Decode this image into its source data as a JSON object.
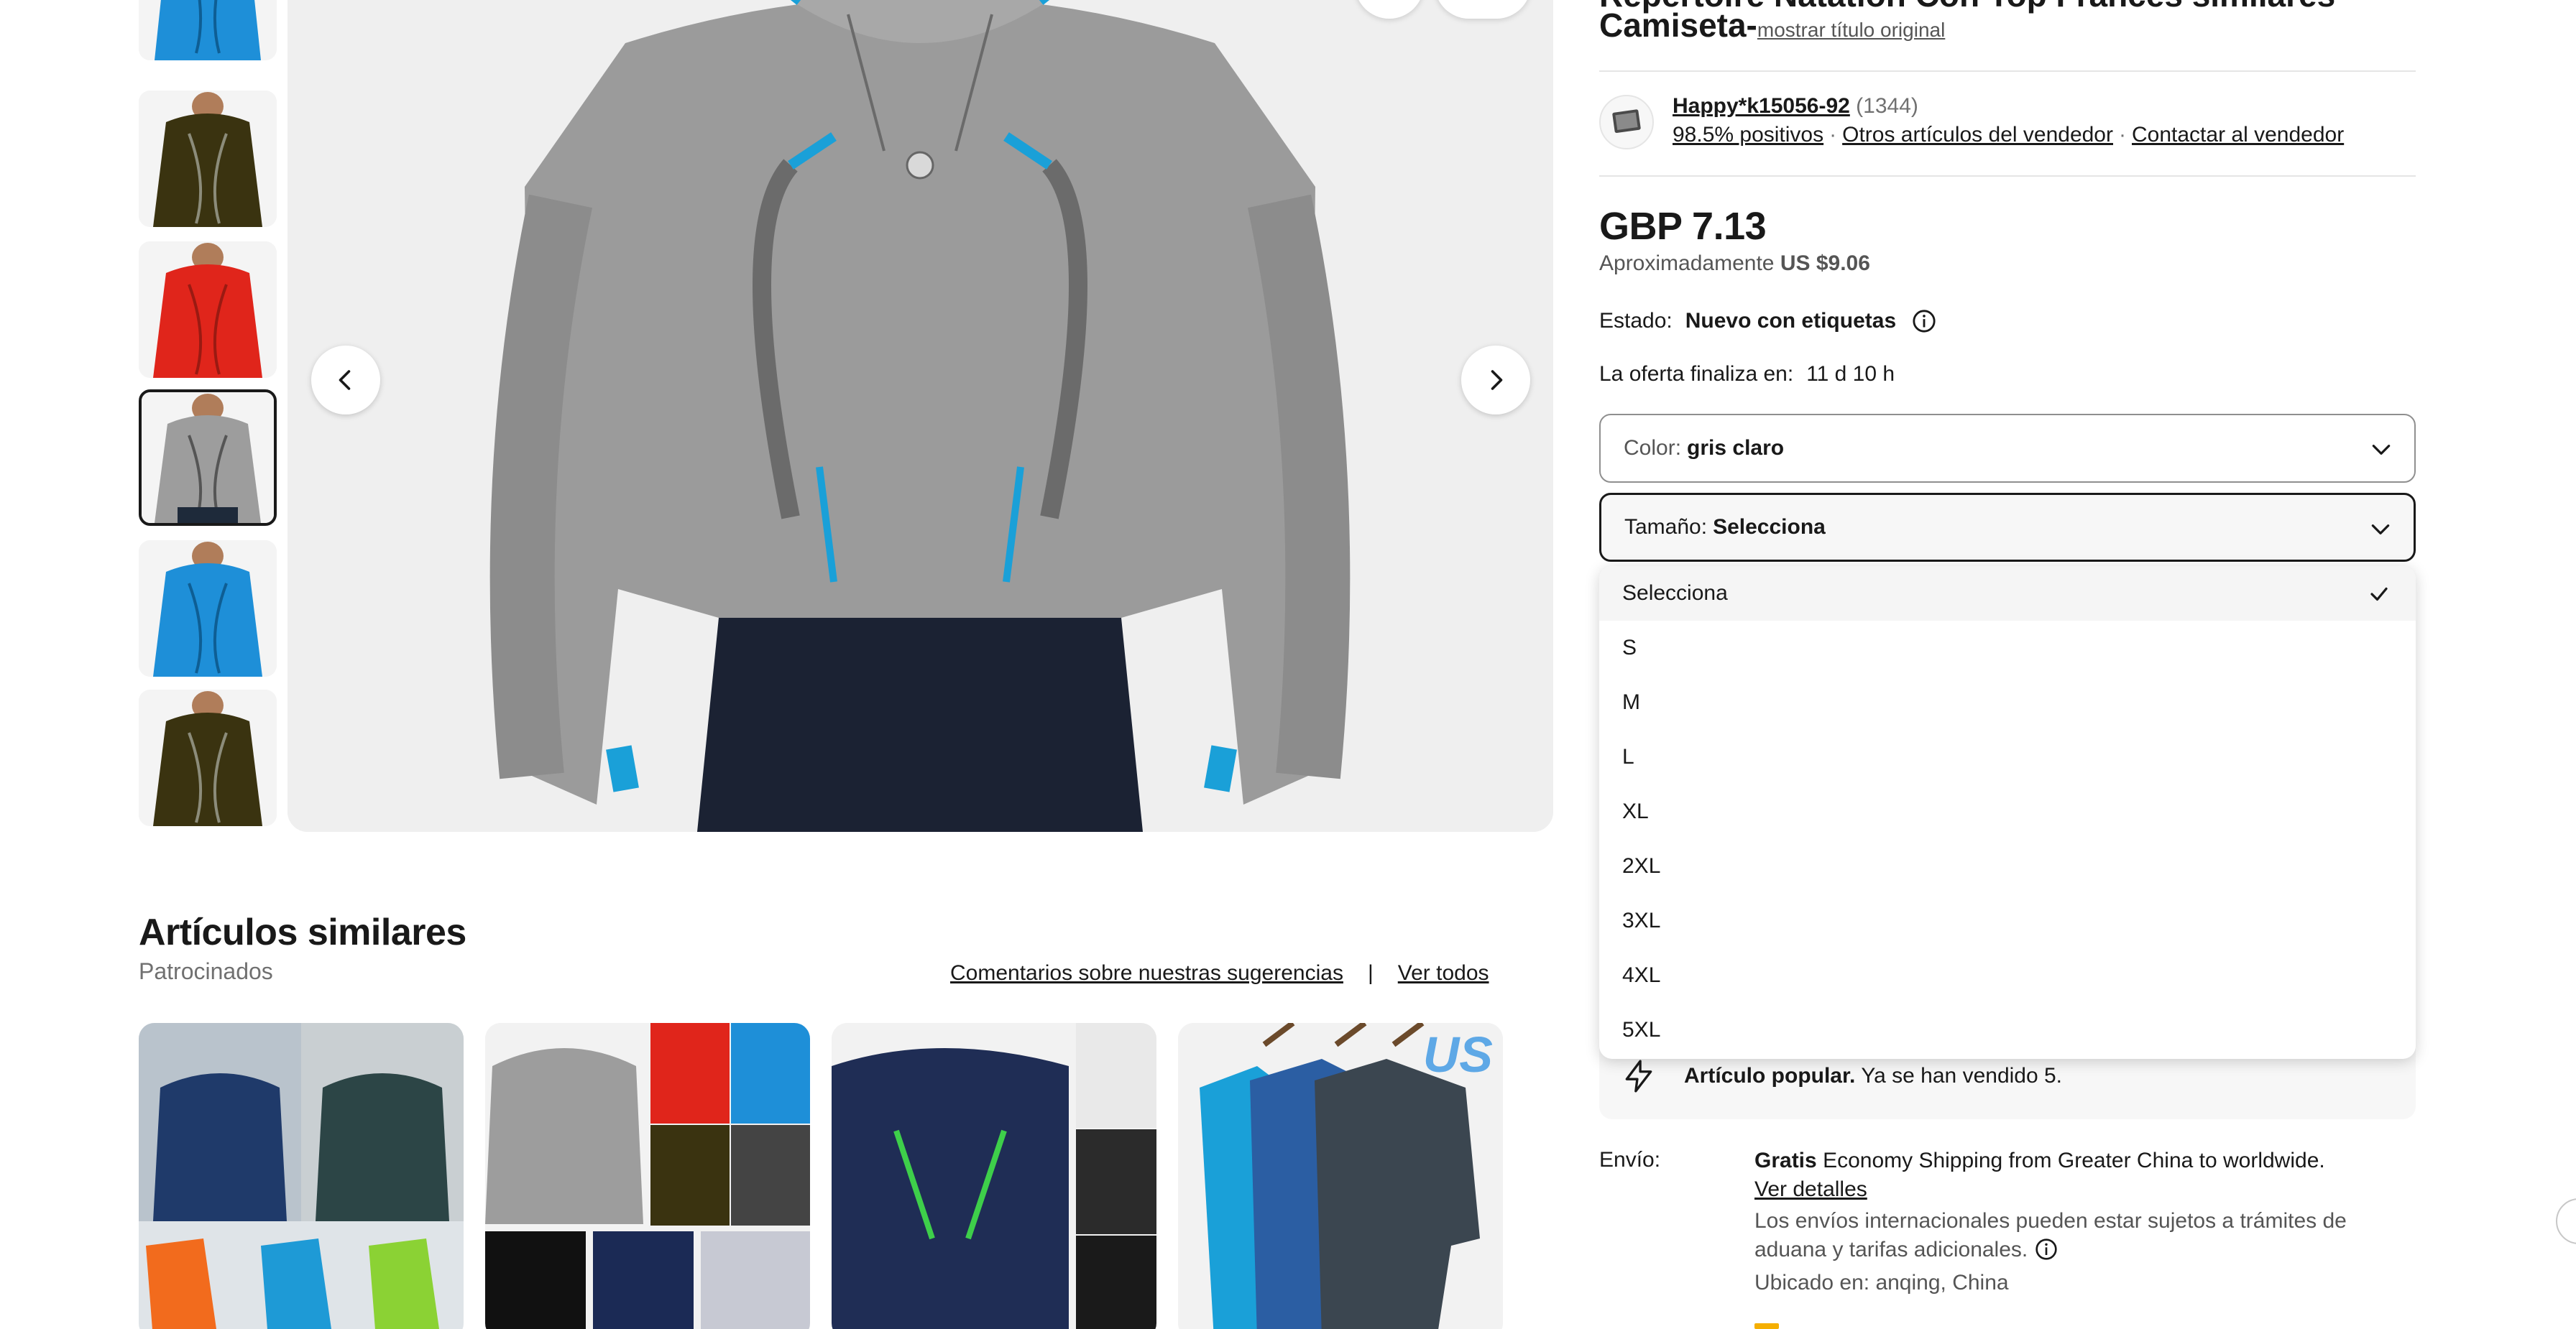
{
  "product": {
    "title_top": "Répertoire Natation Con Top Frances similarés",
    "title_line": "Camiseta-",
    "show_original": "mostrar título original"
  },
  "seller": {
    "name": "Happy*k15056-92",
    "feedback_count": "(1344)",
    "positive": "98.5% positivos",
    "other_items": "Otros artículos del vendedor",
    "contact": "Contactar al vendedor"
  },
  "price": {
    "main": "GBP 7.13",
    "approx_label": "Aproximadamente",
    "approx_value": "US $9.06"
  },
  "condition": {
    "label": "Estado:",
    "value": "Nuevo con etiquetas"
  },
  "offer": {
    "label": "La oferta finaliza en:",
    "value": "11 d 10 h"
  },
  "color_select": {
    "label": "Color:",
    "value": "gris claro"
  },
  "size_select": {
    "label": "Tamaño:",
    "value": "Selecciona",
    "options": [
      "Selecciona",
      "S",
      "M",
      "L",
      "XL",
      "2XL",
      "3XL",
      "4XL",
      "5XL"
    ],
    "selected_index": 0
  },
  "popular": {
    "bold": "Artículo popular.",
    "text": "Ya se han vendido 5."
  },
  "shipping": {
    "label": "Envío:",
    "free": "Gratis",
    "method": "Economy Shipping from Greater China to worldwide.",
    "details_link": "Ver detalles",
    "customs_note": "Los envíos internacionales pueden estar sujetos a trámites de aduana y tarifas adicionales.",
    "location": "Ubicado en: anqing, China"
  },
  "similar": {
    "title": "Artículos similares",
    "subtitle": "Patrocinados",
    "feedback_link": "Comentarios sobre nuestras sugerencias",
    "separator": "|",
    "see_all": "Ver todos",
    "card4_badge": "US"
  },
  "thumbnails": [
    {
      "color": "#1e8fd8"
    },
    {
      "color": "#3a3310"
    },
    {
      "color": "#e0251b"
    },
    {
      "color": "#9d9d9d"
    },
    {
      "color": "#1e8fd8"
    },
    {
      "color": "#3a3310"
    }
  ],
  "colors": {
    "text": "#191919",
    "muted": "#707070",
    "border": "#8f8f8f",
    "accent_cyan": "#1aa0d8"
  }
}
